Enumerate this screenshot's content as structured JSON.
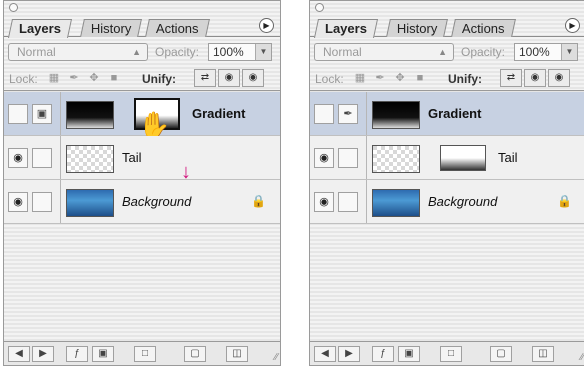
{
  "panels": [
    {
      "tabs": [
        "Layers",
        "History",
        "Actions"
      ],
      "blend_mode": "Normal",
      "opacity_label": "Opacity:",
      "opacity_value": "100%",
      "lock_label": "Lock:",
      "unify_label": "Unify:",
      "layers": [
        {
          "name": "Gradient",
          "visible": false,
          "selected": true,
          "style": "bold"
        },
        {
          "name": "Tail",
          "visible": true,
          "selected": false,
          "style": "normal"
        },
        {
          "name": "Background",
          "visible": true,
          "selected": false,
          "style": "italic",
          "locked": true
        }
      ]
    },
    {
      "tabs": [
        "Layers",
        "History",
        "Actions"
      ],
      "blend_mode": "Normal",
      "opacity_label": "Opacity:",
      "opacity_value": "100%",
      "lock_label": "Lock:",
      "unify_label": "Unify:",
      "layers": [
        {
          "name": "Gradient",
          "visible": false,
          "selected": true,
          "style": "bold"
        },
        {
          "name": "Tail",
          "visible": true,
          "selected": false,
          "style": "normal"
        },
        {
          "name": "Background",
          "visible": true,
          "selected": false,
          "style": "italic",
          "locked": true
        }
      ]
    }
  ],
  "colors": {
    "selected_row": "#c7d1e2",
    "drag_arrow": "#d1127c"
  },
  "icons": {
    "visibility": "eye-icon",
    "brush": "brush-icon",
    "mask": "mask-icon",
    "lock": "lock-icon",
    "cursor": "grab-hand-icon",
    "arrow": "arrow-down-icon"
  }
}
